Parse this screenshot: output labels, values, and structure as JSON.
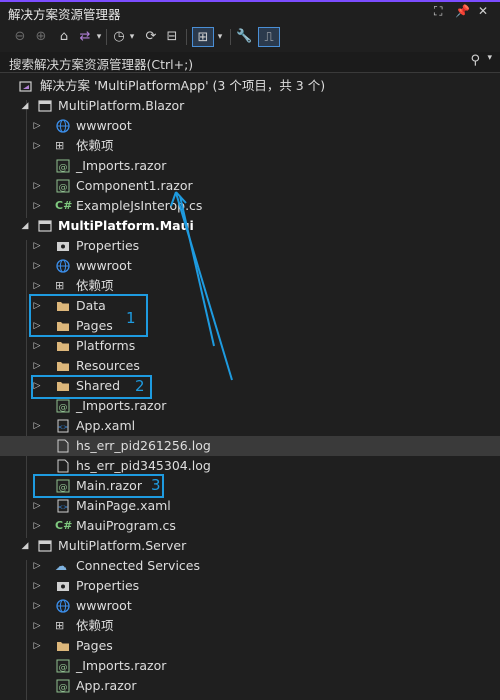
{
  "window": {
    "title": "解决方案资源管理器",
    "buttons": [
      "⛶",
      "📌",
      "✕"
    ]
  },
  "search": {
    "label": "搜索解决方案资源管理器(Ctrl+;)"
  },
  "tree": {
    "solution": "解决方案 'MultiPlatformApp' (3 个项目，共 3 个)",
    "blazor": {
      "name": "MultiPlatform.Blazor",
      "items": [
        "wwwroot",
        "依赖项",
        "_Imports.razor",
        "Component1.razor",
        "ExampleJsInterop.cs"
      ]
    },
    "maui": {
      "name": "MultiPlatform.Maui",
      "items": [
        "Properties",
        "wwwroot",
        "依赖项",
        "Data",
        "Pages",
        "Platforms",
        "Resources",
        "Shared",
        "_Imports.razor",
        "App.xaml",
        "hs_err_pid261256.log",
        "hs_err_pid345304.log",
        "Main.razor",
        "MainPage.xaml",
        "MauiProgram.cs"
      ]
    },
    "server": {
      "name": "MultiPlatform.Server",
      "items": [
        "Connected Services",
        "Properties",
        "wwwroot",
        "依赖项",
        "Pages",
        "_Imports.razor",
        "App.razor"
      ]
    }
  },
  "annotations": [
    "1",
    "2",
    "3"
  ],
  "colors": {
    "accent": "#1e9be0",
    "titlebar_border": "#7c4dff",
    "folder": "#dcb67a",
    "globe": "#3b8eea"
  }
}
